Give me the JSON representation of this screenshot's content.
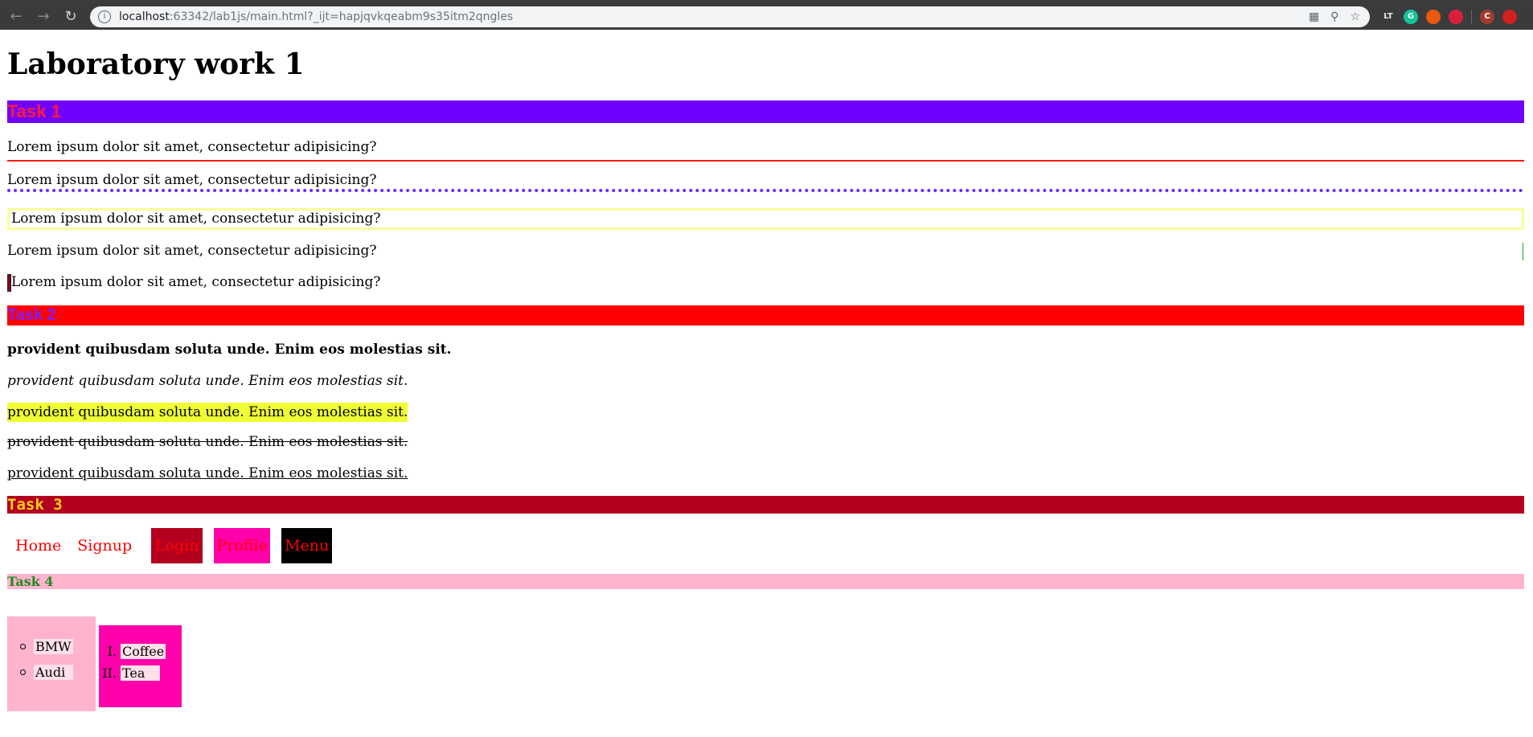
{
  "browser": {
    "url_host": "localhost",
    "url_rest": ":63342/lab1js/main.html?_ijt=hapjqvkqeabm9s35itm2qngles",
    "extensions": [
      "LT",
      "G",
      "C"
    ]
  },
  "page": {
    "title": "Laboratory work 1",
    "task1": {
      "heading": "Task 1",
      "lines": [
        "Lorem ipsum dolor sit amet, consectetur adipisicing?",
        "Lorem ipsum dolor sit amet, consectetur adipisicing?",
        "Lorem ipsum dolor sit amet, consectetur adipisicing?",
        "Lorem ipsum dolor sit amet, consectetur adipisicing?",
        "Lorem ipsum dolor sit amet, consectetur adipisicing?"
      ]
    },
    "task2": {
      "heading": "Task 2",
      "lines": [
        "provident quibusdam soluta unde. Enim eos molestias sit.",
        "provident quibusdam soluta unde. Enim eos molestias sit.",
        "provident quibusdam soluta unde. Enim eos molestias sit.",
        "provident quibusdam soluta unde. Enim eos molestias sit.",
        "provident quibusdam soluta unde. Enim eos molestias sit."
      ]
    },
    "task3": {
      "heading": "Task 3",
      "nav": [
        "Home",
        "Signup",
        "Login",
        "Profile",
        "Menu"
      ]
    },
    "task4": {
      "heading": "Task 4",
      "unordered": [
        "BMW",
        "Audi"
      ],
      "ordered": [
        "Coffee",
        "Tea"
      ],
      "ordered_markers": [
        "I.",
        "II."
      ]
    }
  }
}
